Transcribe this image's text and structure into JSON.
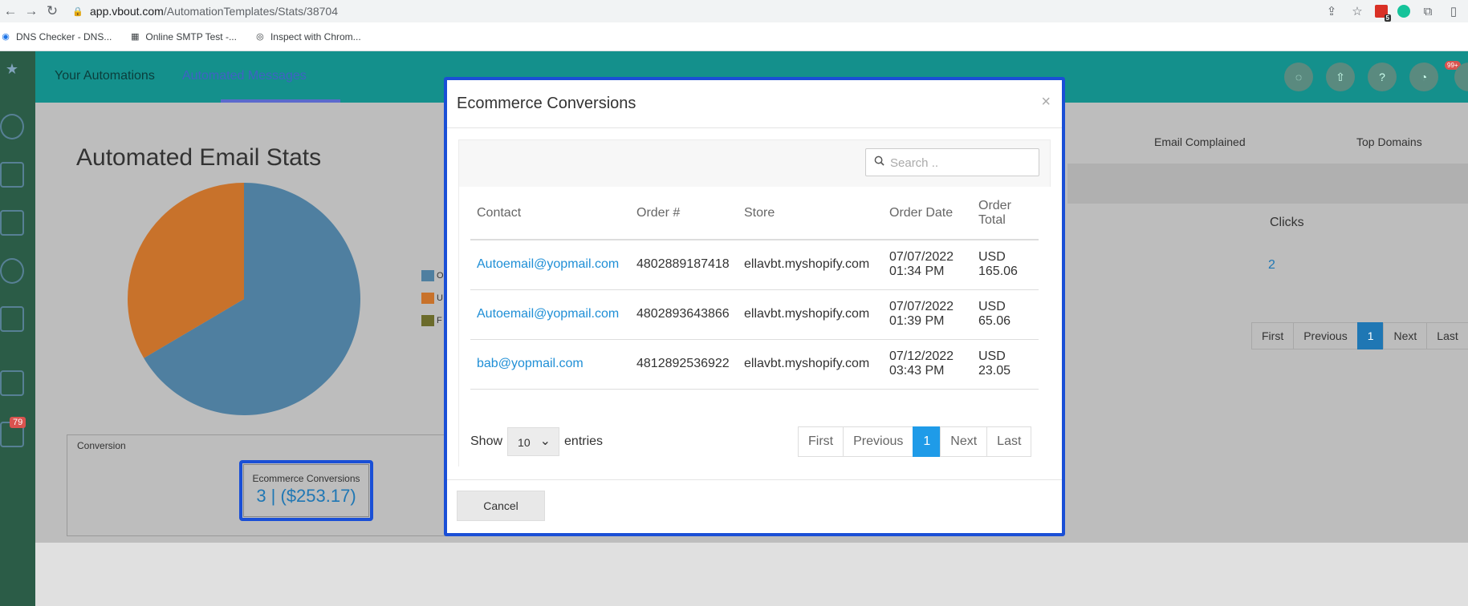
{
  "browser": {
    "back_icon": "back-arrow-icon",
    "forward_icon": "forward-arrow-icon",
    "reload_icon": "reload-icon",
    "url_host": "app.vbout.com",
    "url_path": "/AutomationTemplates/Stats/38704",
    "extension_badge": "5",
    "bookmarks": [
      {
        "label": "DNS Checker - DNS..."
      },
      {
        "label": "Online SMTP Test -..."
      },
      {
        "label": "Inspect with Chrom..."
      }
    ]
  },
  "app": {
    "nav_tabs": [
      {
        "label": "Your Automations"
      },
      {
        "label": "Automated Messages"
      }
    ],
    "sidebar_badge": "79",
    "notification_badge": "99+",
    "help_label": "?",
    "page_title": "Automated Email Stats",
    "background_columns": {
      "email_complained": "Email Complained",
      "top_domains": "Top Domains",
      "clicks": "Clicks",
      "clicks_value": "2"
    },
    "legend_items": [
      {
        "short": "O",
        "color": "#4f7fa0"
      },
      {
        "short": "U",
        "color": "#c8722b"
      },
      {
        "short": "F",
        "color": "#6b6b2b"
      }
    ],
    "pie_colors": {
      "primary": "#4f7fa0",
      "secondary": "#c8722b"
    },
    "background_pager": [
      "First",
      "Previous",
      "1",
      "Next",
      "Last"
    ],
    "conversion": {
      "box_title": "Conversion",
      "label": "Ecommerce Conversions",
      "value": "3 | ($253.17)"
    }
  },
  "modal": {
    "title": "Ecommerce Conversions",
    "close_symbol": "×",
    "search_placeholder": "Search ..",
    "columns": [
      "Contact",
      "Order #",
      "Store",
      "Order Date",
      "Order Total"
    ],
    "rows": [
      {
        "contact": "Autoemail@yopmail.com",
        "order": "4802889187418",
        "store": "ellavbt.myshopify.com",
        "date": "07/07/2022 01:34 PM",
        "total": "USD 165.06"
      },
      {
        "contact": "Autoemail@yopmail.com",
        "order": "4802893643866",
        "store": "ellavbt.myshopify.com",
        "date": "07/07/2022 01:39 PM",
        "total": "USD 65.06"
      },
      {
        "contact": "bab@yopmail.com",
        "order": "4812892536922",
        "store": "ellavbt.myshopify.com",
        "date": "07/12/2022 03:43 PM",
        "total": "USD 23.05"
      }
    ],
    "show_label": "Show",
    "entries_value": "10",
    "entries_label": "entries",
    "pager": [
      "First",
      "Previous",
      "1",
      "Next",
      "Last"
    ],
    "cancel_label": "Cancel",
    "accent_color": "#1a4fd6"
  }
}
